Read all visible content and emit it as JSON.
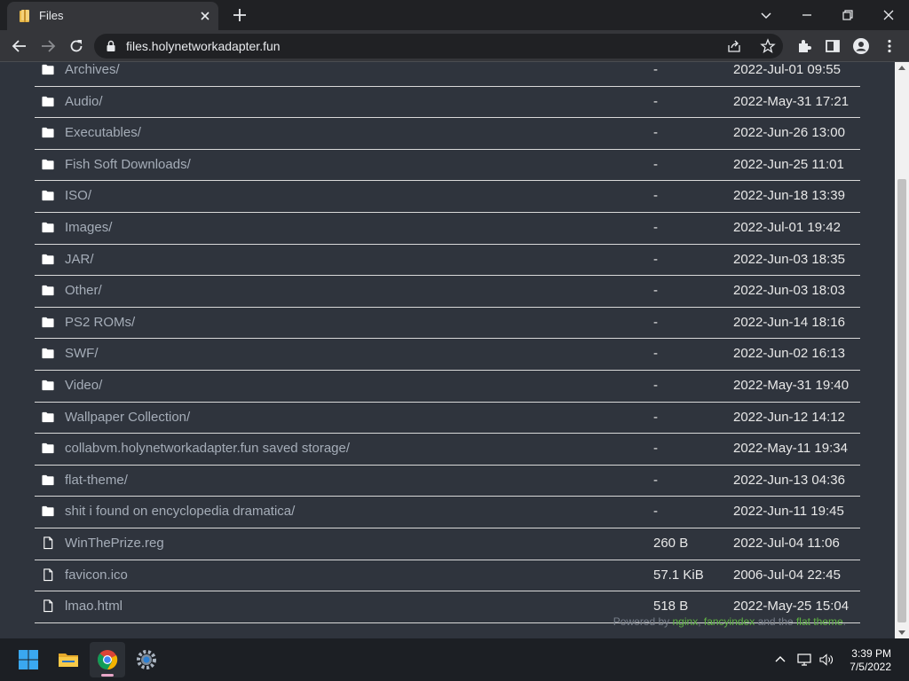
{
  "browser": {
    "tab_title": "Files",
    "url": "files.holynetworkadapter.fun"
  },
  "listing": [
    {
      "type": "folder",
      "name": "Archives/",
      "size": "-",
      "date": "2022-Jul-01 09:55"
    },
    {
      "type": "folder",
      "name": "Audio/",
      "size": "-",
      "date": "2022-May-31 17:21"
    },
    {
      "type": "folder",
      "name": "Executables/",
      "size": "-",
      "date": "2022-Jun-26 13:00"
    },
    {
      "type": "folder",
      "name": "Fish Soft Downloads/",
      "size": "-",
      "date": "2022-Jun-25 11:01"
    },
    {
      "type": "folder",
      "name": "ISO/",
      "size": "-",
      "date": "2022-Jun-18 13:39"
    },
    {
      "type": "folder",
      "name": "Images/",
      "size": "-",
      "date": "2022-Jul-01 19:42"
    },
    {
      "type": "folder",
      "name": "JAR/",
      "size": "-",
      "date": "2022-Jun-03 18:35"
    },
    {
      "type": "folder",
      "name": "Other/",
      "size": "-",
      "date": "2022-Jun-03 18:03"
    },
    {
      "type": "folder",
      "name": "PS2 ROMs/",
      "size": "-",
      "date": "2022-Jun-14 18:16"
    },
    {
      "type": "folder",
      "name": "SWF/",
      "size": "-",
      "date": "2022-Jun-02 16:13"
    },
    {
      "type": "folder",
      "name": "Video/",
      "size": "-",
      "date": "2022-May-31 19:40"
    },
    {
      "type": "folder",
      "name": "Wallpaper Collection/",
      "size": "-",
      "date": "2022-Jun-12 14:12"
    },
    {
      "type": "folder",
      "name": "collabvm.holynetworkadapter.fun saved storage/",
      "size": "-",
      "date": "2022-May-11 19:34"
    },
    {
      "type": "folder",
      "name": "flat-theme/",
      "size": "-",
      "date": "2022-Jun-13 04:36"
    },
    {
      "type": "folder",
      "name": "shit i found on encyclopedia dramatica/",
      "size": "-",
      "date": "2022-Jun-11 19:45"
    },
    {
      "type": "file",
      "name": "WinThePrize.reg",
      "size": "260 B",
      "date": "2022-Jul-04 11:06"
    },
    {
      "type": "file",
      "name": "favicon.ico",
      "size": "57.1 KiB",
      "date": "2006-Jul-04 22:45"
    },
    {
      "type": "file",
      "name": "lmao.html",
      "size": "518 B",
      "date": "2022-May-25 15:04"
    }
  ],
  "footer": {
    "prefix": "Powered by ",
    "link1": "nginx",
    "sep1": ", ",
    "link2": "fancyindex",
    "mid": " and the ",
    "link3": "flat theme",
    "suffix": "."
  },
  "taskbar": {
    "apps": [
      "start-icon",
      "file-explorer-icon",
      "chrome-icon",
      "settings-icon"
    ],
    "time": "3:39 PM",
    "date": "7/5/2022"
  },
  "colors": {
    "page_bg": "#2f343d",
    "link_green": "#5fb343",
    "row_divider": "#d9d9d9"
  }
}
